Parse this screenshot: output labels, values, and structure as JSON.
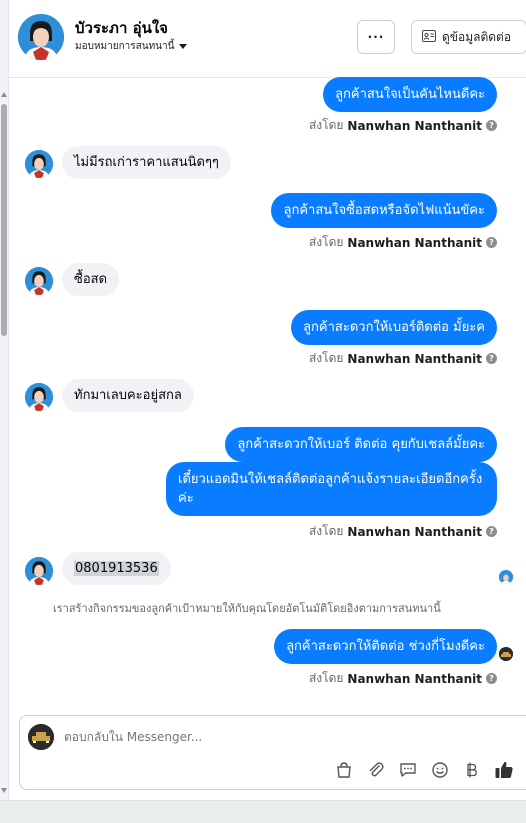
{
  "header": {
    "contact_name": "บัวระภา อุ่นใจ",
    "assign_label": "มอบหมายการสนทนานี้",
    "more_label": "···",
    "contact_info_label": "ดูข้อมูลติดต่อ"
  },
  "messages": [
    {
      "type": "out",
      "text": "ลูกค้าสนใจเป็นคันไหนดีคะ"
    },
    {
      "type": "sent_by",
      "prefix": "ส่งโดย",
      "name": "Nanwhan Nanthanit"
    },
    {
      "type": "in",
      "text": "ไม่มีรถเก่าราคาแสนนิดๆๆ"
    },
    {
      "type": "out",
      "text": "ลูกค้าสนใจซื้อสดหรือจัดไฟแน้นขัคะ"
    },
    {
      "type": "sent_by",
      "prefix": "ส่งโดย",
      "name": "Nanwhan Nanthanit"
    },
    {
      "type": "in",
      "text": "ซื้อสด"
    },
    {
      "type": "out",
      "text": "ลูกค้าสะดวกให้เบอร์ติดต่อ มั้ยะค"
    },
    {
      "type": "sent_by",
      "prefix": "ส่งโดย",
      "name": "Nanwhan Nanthanit"
    },
    {
      "type": "in",
      "text": "ทักมาเลบคะอยู่สกล"
    },
    {
      "type": "out",
      "text": "ลูกค้าสะดวกให้เบอร์ ติดต่อ คุยกับเชลล์มั้ยคะ"
    },
    {
      "type": "out",
      "text": "เดี๋ยวแอดมินให้เชลล์ติดต่อลูกค้าแจ้งรายละเอียดอีกครั้งค่ะ"
    },
    {
      "type": "sent_by",
      "prefix": "ส่งโดย",
      "name": "Nanwhan Nanthanit"
    },
    {
      "type": "in",
      "text": "0801913536"
    },
    {
      "type": "system",
      "text": "เราสร้างกิจกรรมของลูกค้าเป้าหมายให้กับคุณโดยอัตโนมัติโดยอิงตามการสนทนานี้"
    },
    {
      "type": "out",
      "text": "ลูกค้าสะดวกให้ติดต่อ ช่วงกี่โมงดีคะ"
    },
    {
      "type": "sent_by",
      "prefix": "ส่งโดย",
      "name": "Nanwhan Nanthanit"
    }
  ],
  "composer": {
    "placeholder": "ตอบกลับใน Messenger..."
  },
  "icons": {
    "more": "more-options-icon",
    "contact": "contact-card-icon",
    "help": "help-icon",
    "bag": "shopping-bag-icon",
    "attach": "paperclip-icon",
    "saved": "saved-reply-icon",
    "emoji": "emoji-icon",
    "currency": "baht-icon",
    "like": "thumbs-up-icon"
  },
  "colors": {
    "outgoing_bubble": "#0a7cff",
    "incoming_bubble": "#f0f2f5",
    "like_icon": "#0a7cff"
  }
}
